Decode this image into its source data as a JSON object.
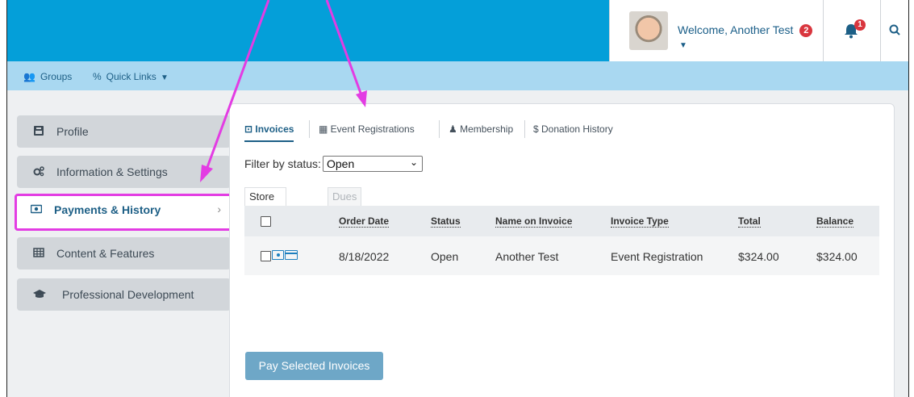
{
  "header": {
    "welcome": "Welcome, Another Test",
    "welcome_badge": "2",
    "notification_badge": "1"
  },
  "subnav": {
    "groups": "Groups",
    "quick_links": "Quick Links"
  },
  "sidebar": {
    "items": [
      {
        "label": "Profile",
        "icon": "profile-card-icon"
      },
      {
        "label": "Information & Settings",
        "icon": "gears-icon"
      },
      {
        "label": "Payments & History",
        "icon": "money-icon",
        "active": true
      },
      {
        "label": "Content & Features",
        "icon": "table-icon"
      },
      {
        "label": "Professional Development",
        "icon": "graduation-cap-icon"
      }
    ]
  },
  "tabs": {
    "invoices": "Invoices",
    "event_registrations": "Event Registrations",
    "membership": "Membership",
    "donation_history": "Donation History"
  },
  "filter": {
    "label": "Filter by status:",
    "value": "Open"
  },
  "subtabs": {
    "store_events": "Store & Events",
    "dues": "Dues"
  },
  "table": {
    "headers": [
      "Order Date",
      "Status",
      "Name on Invoice",
      "Invoice Type",
      "Total",
      "Balance"
    ],
    "rows": [
      {
        "order_date": "8/18/2022",
        "status": "Open",
        "name": "Another Test",
        "type": "Event Registration",
        "total": "$324.00",
        "balance": "$324.00"
      }
    ]
  },
  "actions": {
    "pay": "Pay Selected Invoices"
  },
  "colors": {
    "topbar": "#049fd9",
    "subnav": "#a9d8f1",
    "highlight": "#e33ce3",
    "button": "#6ea7c7"
  }
}
